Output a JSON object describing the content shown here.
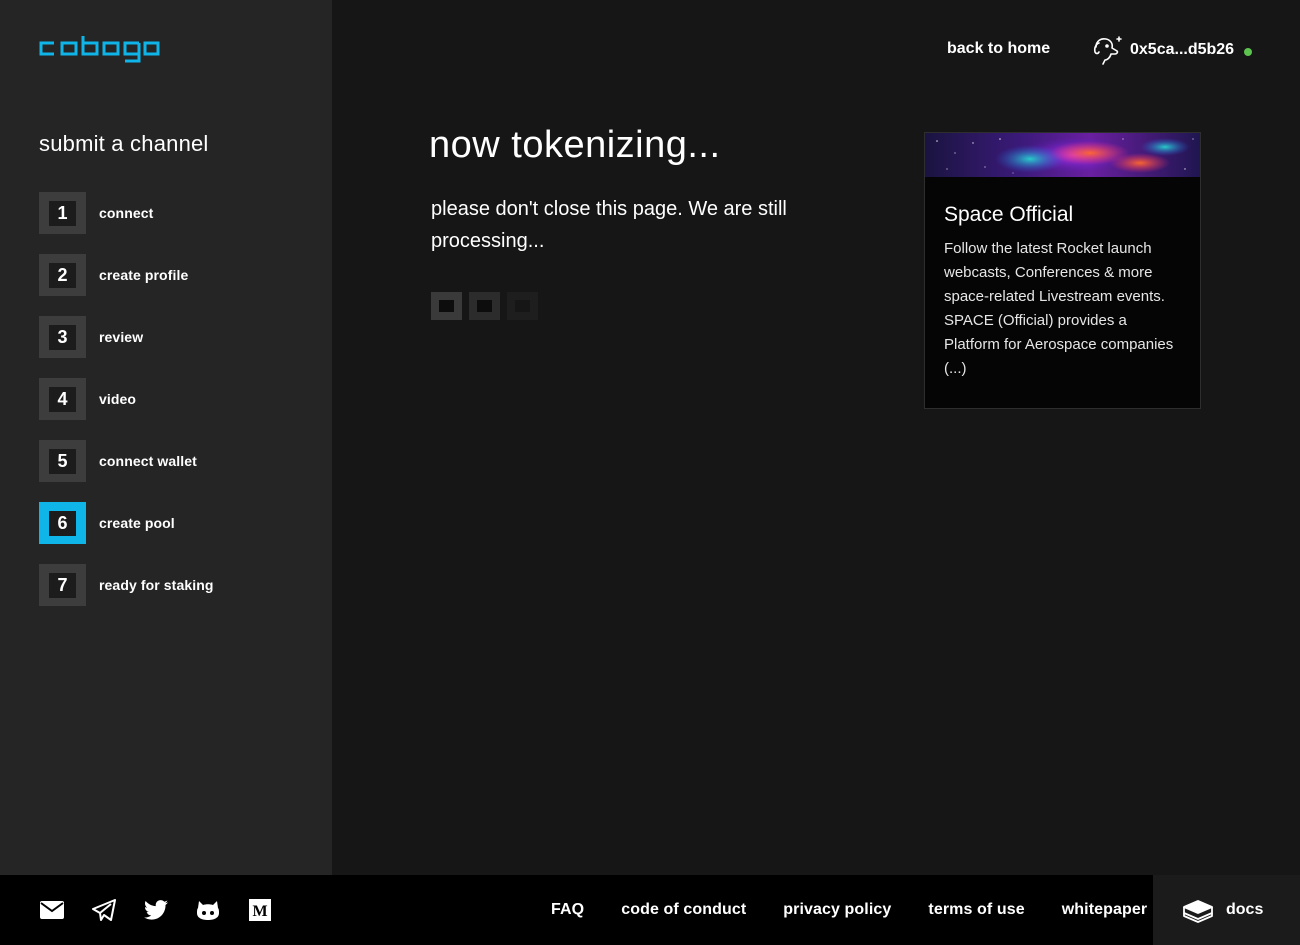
{
  "brand": {
    "name": "cobogo",
    "accent": "#0fb5e8"
  },
  "header": {
    "back_home": "back to home",
    "wallet_address": "0x5ca...d5b26",
    "wallet_status_color": "#5cc44e"
  },
  "sidebar": {
    "title": "submit a channel",
    "steps": [
      {
        "num": "1",
        "label": "connect"
      },
      {
        "num": "2",
        "label": "create profile"
      },
      {
        "num": "3",
        "label": "review"
      },
      {
        "num": "4",
        "label": "video"
      },
      {
        "num": "5",
        "label": "connect wallet"
      },
      {
        "num": "6",
        "label": "create pool",
        "active": true
      },
      {
        "num": "7",
        "label": "ready for staking"
      }
    ]
  },
  "main": {
    "title": "now tokenizing...",
    "message": "please don't close this page. We are still processing..."
  },
  "card": {
    "title": "Space Official",
    "description": "Follow the latest Rocket launch webcasts, Conferences & more space-related Livestream events. SPACE (Official) provides a Platform for Aerospace companies (...)"
  },
  "footer": {
    "social_icons": [
      "mail-icon",
      "telegram-icon",
      "twitter-icon",
      "github-icon",
      "medium-icon"
    ],
    "links": [
      "FAQ",
      "code of conduct",
      "privacy policy",
      "terms of use",
      "whitepaper"
    ],
    "docs_label": "docs"
  }
}
